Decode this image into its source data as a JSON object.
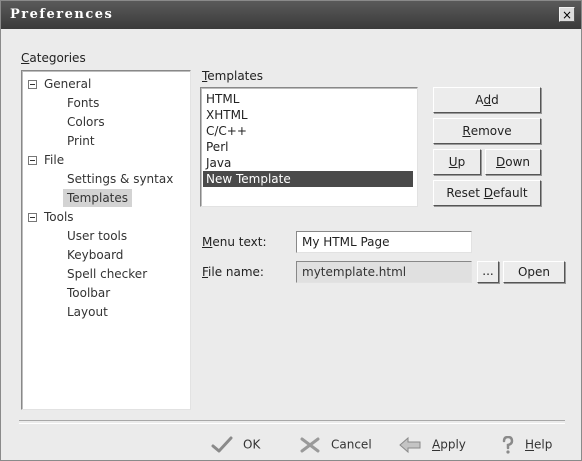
{
  "window": {
    "title": "Preferences",
    "close_glyph": "×"
  },
  "categories": {
    "label_u": "C",
    "label_rest": "ategories",
    "items": [
      {
        "label": "General",
        "level": 0,
        "expander": "collapse"
      },
      {
        "label": "Fonts",
        "level": 1
      },
      {
        "label": "Colors",
        "level": 1
      },
      {
        "label": "Print",
        "level": 1
      },
      {
        "label": "File",
        "level": 0,
        "expander": "collapse"
      },
      {
        "label": "Settings & syntax",
        "level": 1
      },
      {
        "label": "Templates",
        "level": 1,
        "selected": true
      },
      {
        "label": "Tools",
        "level": 0,
        "expander": "collapse"
      },
      {
        "label": "User tools",
        "level": 1
      },
      {
        "label": "Keyboard",
        "level": 1
      },
      {
        "label": "Spell checker",
        "level": 1
      },
      {
        "label": "Toolbar",
        "level": 1
      },
      {
        "label": "Layout",
        "level": 1
      }
    ]
  },
  "templates": {
    "label_u": "T",
    "label_rest": "emplates",
    "items": [
      "HTML",
      "XHTML",
      "C/C++",
      "Perl",
      "Java",
      "New Template"
    ],
    "selected": "New Template"
  },
  "buttons": {
    "add": {
      "pre": "A",
      "u": "d",
      "post": "d"
    },
    "remove": {
      "pre": "",
      "u": "R",
      "post": "emove"
    },
    "up": {
      "pre": "",
      "u": "U",
      "post": "p"
    },
    "down": {
      "pre": "",
      "u": "D",
      "post": "own"
    },
    "reset": {
      "pre": "Reset ",
      "u": "D",
      "post": "efault"
    }
  },
  "menu_text": {
    "label_u": "M",
    "label_rest": "enu text:",
    "value": "My HTML Page"
  },
  "file_name": {
    "label_u": "F",
    "label_rest": "ile name:",
    "value": "mytemplate.html",
    "browse_label": "...",
    "open_label": "Open"
  },
  "footer": {
    "ok": {
      "label": "OK",
      "icon": "check-icon"
    },
    "cancel": {
      "label": "Cancel",
      "icon": "cancel-icon"
    },
    "apply": {
      "label_u": "A",
      "label_rest": "pply",
      "icon": "apply-arrow-icon"
    },
    "help": {
      "label_u": "H",
      "label_rest": "elp",
      "icon": "help-icon"
    }
  },
  "colors": {
    "titlebar": "#3a3a3a",
    "selection": "#4a4a4a",
    "tree_selection": "#d3d3d3"
  }
}
